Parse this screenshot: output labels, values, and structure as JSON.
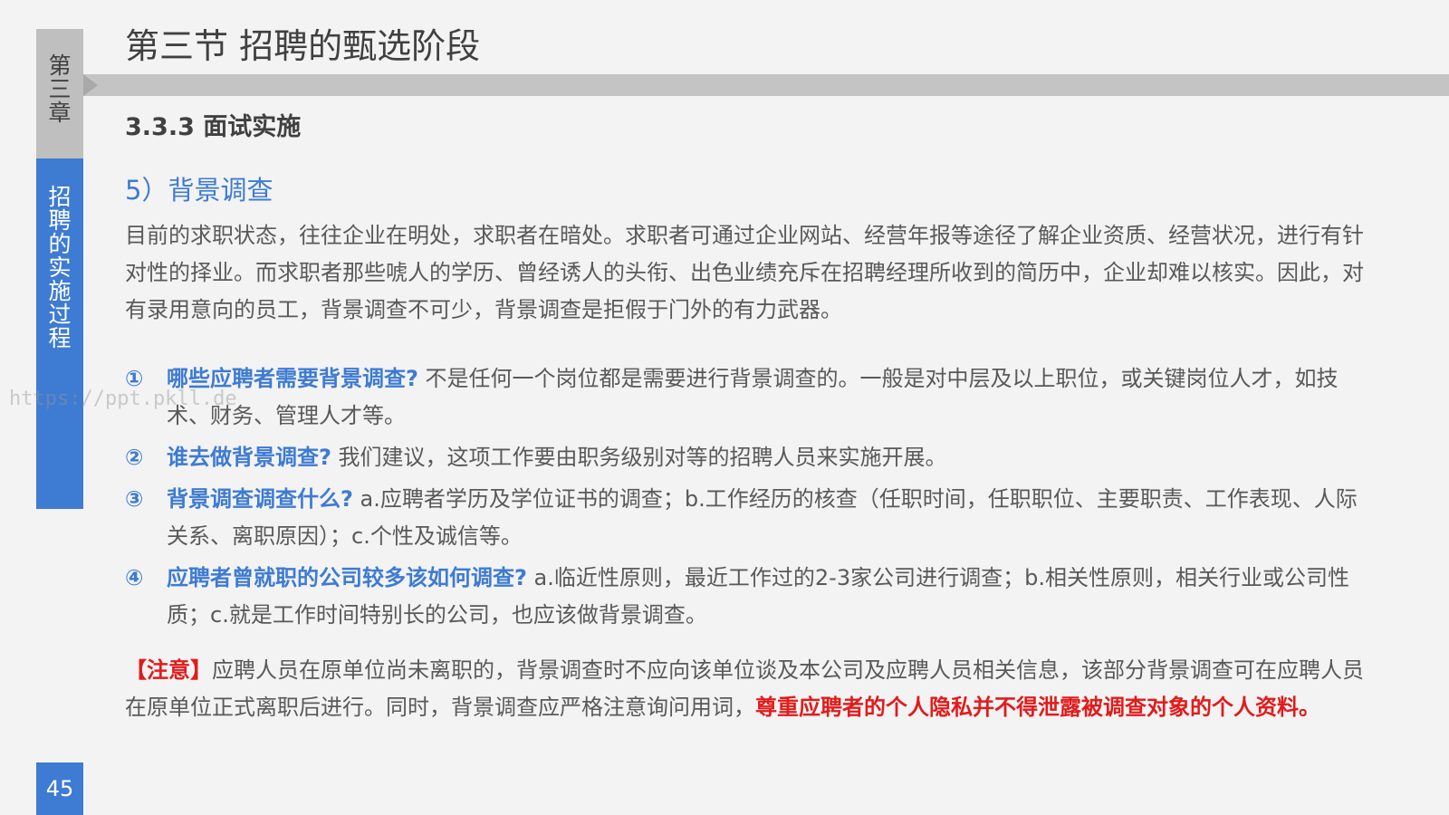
{
  "sidebar": {
    "chapter": "第三章",
    "section": "招聘的实施过程",
    "page_number": "45"
  },
  "header": {
    "title": "第三节  招聘的甄选阶段",
    "subheading": "3.3.3 面试实施"
  },
  "content": {
    "topic": "5）背景调查",
    "intro": "目前的求职状态，往往企业在明处，求职者在暗处。求职者可通过企业网站、经营年报等途径了解企业资质、经营状况，进行有针对性的择业。而求职者那些唬人的学历、曾经诱人的头衔、出色业绩充斥在招聘经理所收到的简历中，企业却难以核实。因此，对有录用意向的员工，背景调查不可少，背景调查是拒假于门外的有力武器。",
    "items": [
      {
        "num": "①",
        "question": "哪些应聘者需要背景调查?",
        "answer": " 不是任何一个岗位都是需要进行背景调查的。一般是对中层及以上职位，或关键岗位人才，如技术、财务、管理人才等。"
      },
      {
        "num": "②",
        "question": "谁去做背景调查?",
        "answer": " 我们建议，这项工作要由职务级别对等的招聘人员来实施开展。"
      },
      {
        "num": "③",
        "question": "背景调查调查什么?",
        "answer": " a.应聘者学历及学位证书的调查；b.工作经历的核查（任职时间，任职职位、主要职责、工作表现、人际关系、离职原因）；c.个性及诚信等。"
      },
      {
        "num": "④",
        "question": "应聘者曾就职的公司较多该如何调查?",
        "answer": "  a.临近性原则，最近工作过的2-3家公司进行调查；b.相关性原则，相关行业或公司性质；c.就是工作时间特别长的公司，也应该做背景调查。"
      }
    ],
    "note": {
      "label": "【注意】",
      "text": "应聘人员在原单位尚未离职的，背景调查时不应向该单位谈及本公司及应聘人员相关信息，该部分背景调查可在应聘人员在原单位正式离职后进行。同时，背景调查应严格注意询问用词，",
      "emphasis": "尊重应聘者的个人隐私并不得泄露被调查对象的个人资料。"
    }
  },
  "watermark": "https://ppt.pkll.de",
  "colors": {
    "accent_blue": "#3e7bd2",
    "note_red": "#e21b1b",
    "sidebar_gray": "#bfbfbf",
    "background": "#f3f3f3"
  }
}
